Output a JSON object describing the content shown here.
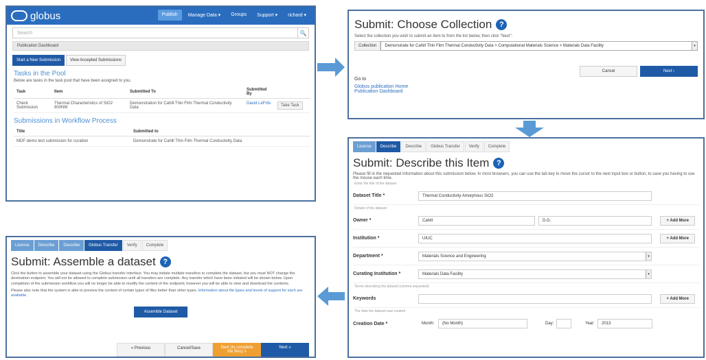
{
  "dashboard": {
    "logo": "globus",
    "nav": [
      "Publish",
      "Manage Data ▾",
      "Groups",
      "Support ▾",
      "richard ▾"
    ],
    "search_placeholder": "Search",
    "breadcrumb": "Publication Dashboard",
    "buttons": [
      "Start a New Submission",
      "View Accepted Submissions"
    ],
    "pool_heading": "Tasks in the Pool",
    "pool_desc": "Below are tasks in the task pool that have been assigned to you.",
    "pool_headers": [
      "Task",
      "Item",
      "Submitted To",
      "Submitted By",
      ""
    ],
    "pool_row": {
      "task": "Check Submission",
      "item": "Thermal Characteristics of SiO2 800NM",
      "to": "Demonstration for Cahill Thin Film Thermal Conductivity Data",
      "by": "David LeFrits",
      "action": "Take Task"
    },
    "workflow_heading": "Submissions in Workflow Process",
    "workflow_headers": [
      "Title",
      "Submitted to"
    ],
    "workflow_row": {
      "title": "MDF demo test submission for curation",
      "to": "Demonstrate for Cahill Thin Film Thermal Conductivity Data"
    }
  },
  "choose": {
    "title": "Submit: Choose Collection",
    "desc": "Select the collection you wish to submit an item to from the list below, then click \"Next\".",
    "collection_label": "Collection",
    "collection_value": "Demonstrate for Cahill Thin Film Thermal Conductivity Data > Computational Materials Science > Materials Data Facility",
    "cancel": "Cancel",
    "next": "Next ›",
    "goto": "Go to",
    "links": [
      "Globus publication Home",
      "Publication Dashboard"
    ]
  },
  "describe": {
    "tabs": [
      "License",
      "Describe",
      "Describe",
      "Globus Transfer",
      "Verify",
      "Complete"
    ],
    "title": "Submit: Describe this Item",
    "desc": "Please fill in the requested information about this submission below. In most browsers, you can use the tab key to move the cursor to the next input box or button, to save you having to use the mouse each time.",
    "sec1": "Enter the title of the dataset",
    "dataset_title_label": "Dataset Title *",
    "dataset_title": "Thermal Conductivity Amorphous SiO2",
    "sec2": "Details of the dataset",
    "owner_label": "Owner *",
    "owner_first": "Cahill",
    "owner_last": "D.G.",
    "add_more": "+ Add More",
    "institution_label": "Institution *",
    "institution": "UIUC",
    "department_label": "Department *",
    "department": "Materials Science and Engineering",
    "curating_label": "Curating Institution *",
    "curating": "Materials Data Facility",
    "sec3": "Terms describing the dataset (comma separated)",
    "keywords_label": "Keywords",
    "sec4": "The date the dataset was created",
    "date_label": "Creation Date *",
    "month_label": "Month:",
    "month": "(No Month)",
    "day_label": "Day:",
    "year_label": "Year:",
    "year": "2013"
  },
  "assemble": {
    "tabs": [
      "License",
      "Describe",
      "Describe",
      "Globus Transfer",
      "Verify",
      "Complete"
    ],
    "title": "Submit: Assemble a dataset",
    "desc1": "Click the button to assemble your dataset using the Globus transfer interface. You may initiate multiple transfers to complete the dataset, but you must NOT change the destination endpoint. You will not be allowed to complete submission until all transfers are complete. Any transfer which have been initiated will be shown below. Upon completion of the submission workflow you will no longer be able to modify the content of the endpoint; however you will be able to view and download the contents.",
    "desc2": "Please also note that the system is able to preview the content of certain types of files better than other types.",
    "link": "Information about file types and levels of support for each are available.",
    "assemble_button": "Assemble Dataset",
    "footer": [
      "« Previous",
      "Cancel/Save",
      "Next (to complete the files) »",
      "Next »"
    ]
  },
  "colors": {
    "brand": "#2a6dbe",
    "primary": "#1f5aa6",
    "orange": "#f0a030",
    "arrow": "#5a9bd6"
  }
}
